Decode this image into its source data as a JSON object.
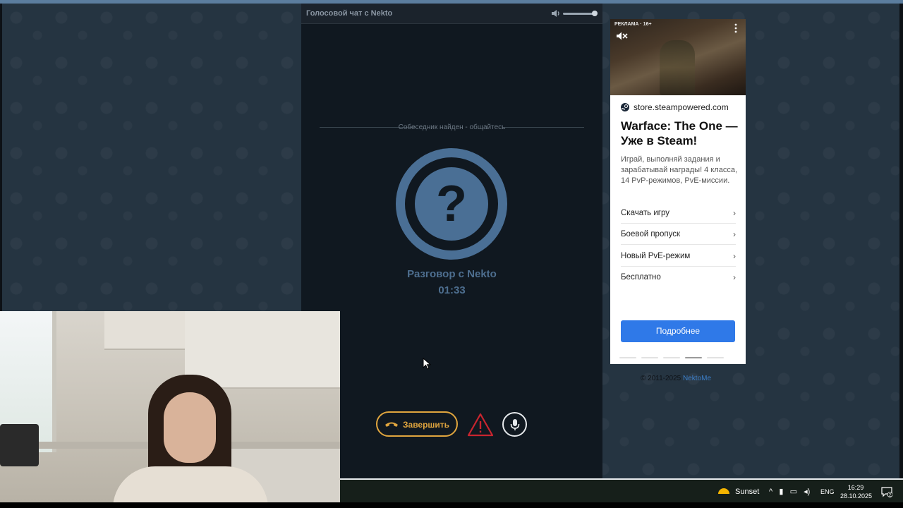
{
  "chat": {
    "title": "Голосовой чат с Nekto",
    "status": "Собеседник найден - общайтесь",
    "peer_name": "Разговор с Nekto",
    "timer": "01:33",
    "end_label": "Завершить"
  },
  "ad": {
    "label": "РЕКЛАМА · 16+",
    "domain": "store.steampowered.com",
    "title": "Warface: The One — Уже в Steam!",
    "description": "Играй, выполняй задания и зарабатывай награды! 4 класса, 14 PvP-режимов, PvE-миссии.",
    "links": [
      "Скачать игру",
      "Боевой пропуск",
      "Новый PvE-режим",
      "Бесплатно"
    ],
    "cta": "Подробнее"
  },
  "footer": {
    "copyright": "© 2011-2025",
    "brand": "NektoMe"
  },
  "taskbar": {
    "weather": "Sunset",
    "language": "ENG",
    "time": "16:29",
    "date": "28.10.2025",
    "notifications": "2"
  },
  "colors": {
    "accent_end": "#e0a53e",
    "warn": "#c9252f",
    "avatar": "#4a6f95",
    "cta": "#2f79e8"
  }
}
